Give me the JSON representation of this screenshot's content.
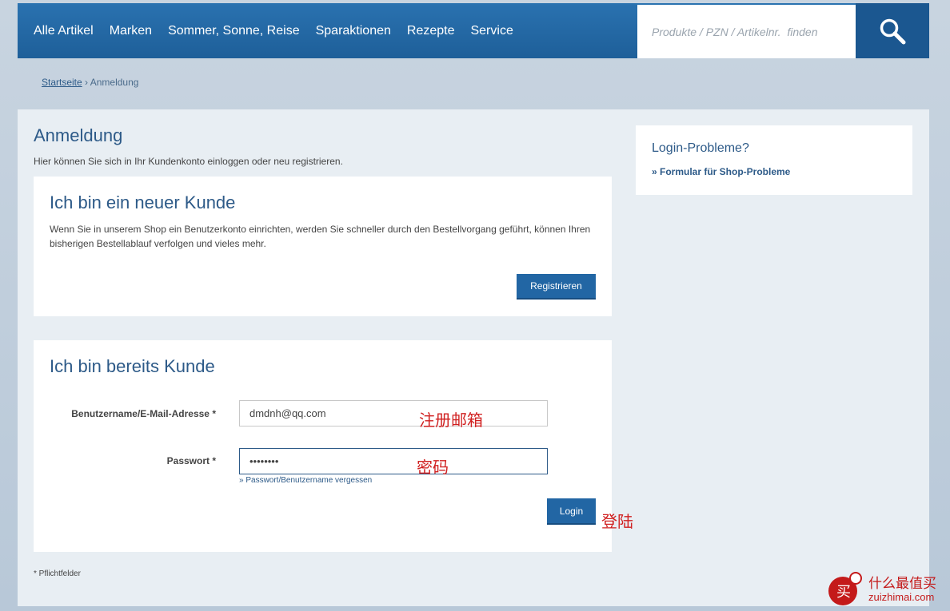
{
  "nav": {
    "items": [
      "Alle Artikel",
      "Marken",
      "Sommer, Sonne, Reise",
      "Sparaktionen",
      "Rezepte",
      "Service"
    ],
    "search_placeholder": "Produkte / PZN / Artikelnr.  finden",
    "search_icon": "search-icon"
  },
  "breadcrumb": {
    "home": "Startseite",
    "separator": "›",
    "current": "Anmeldung"
  },
  "page": {
    "title": "Anmeldung",
    "intro": "Hier können Sie sich in Ihr Kundenkonto einloggen oder neu registrieren.",
    "required_note": "* Pflichtfelder"
  },
  "new_customer": {
    "heading": "Ich bin ein neuer Kunde",
    "text": "Wenn Sie in unserem Shop ein Benutzerkonto einrichten, werden Sie schneller durch den Bestellvorgang geführt, können Ihren bisherigen Bestellablauf verfolgen und vieles mehr.",
    "register_label": "Registrieren"
  },
  "existing_customer": {
    "heading": "Ich bin bereits Kunde",
    "username_label": "Benutzername/E-Mail-Adresse *",
    "username_value": "dmdnh@qq.com",
    "password_label": "Passwort *",
    "password_value": "••••••••",
    "forgot_link": "» Passwort/Benutzername vergessen",
    "login_label": "Login"
  },
  "annotations": {
    "email": "注册邮箱",
    "password": "密码",
    "login": "登陆"
  },
  "sidebar": {
    "heading": "Login-Probleme?",
    "link": "» Formular für Shop-Probleme"
  },
  "watermark": {
    "line1": "什么最值买",
    "line2": "zuizhimai.com"
  },
  "colors": {
    "nav_bg": "#1e5f99",
    "accent": "#2d5a88",
    "button": "#2266a4",
    "annotation": "#d02020"
  }
}
